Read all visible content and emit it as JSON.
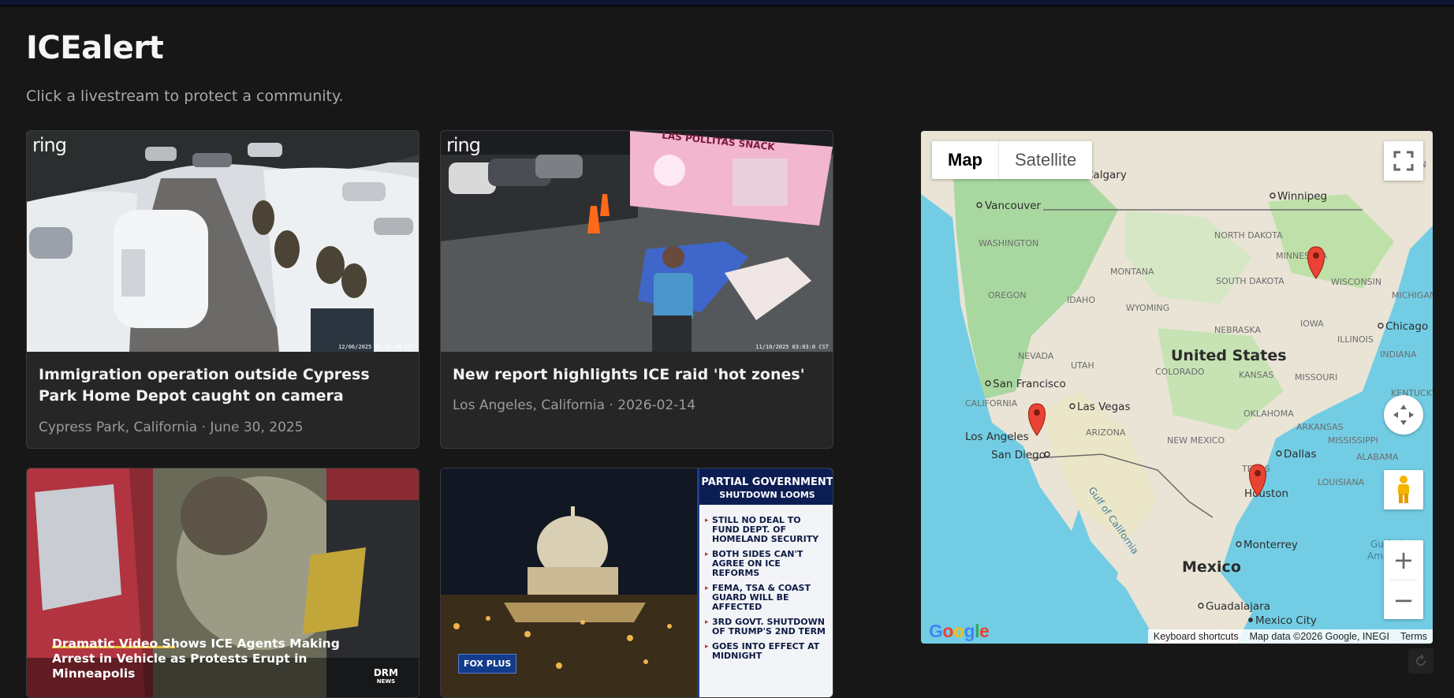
{
  "app": {
    "title": "ICEalert",
    "subtitle": "Click a livestream to protect a community."
  },
  "cards": [
    {
      "title": "Immigration operation outside Cypress Park Home Depot caught on camera",
      "meta": "Cypress Park, California · June 30, 2025",
      "brand": "ring",
      "timestamp": "12/06/2025 01:54:08 CST"
    },
    {
      "title": "New report highlights ICE raid 'hot zones'",
      "meta": "Los Angeles, California · 2026-02-14",
      "brand": "ring",
      "timestamp": "11/10/2025 03:03:0 CST",
      "sign": "LAS POLLITAS SNACK"
    },
    {
      "caption": "Dramatic Video Shows ICE Agents Making Arrest in Vehicle as Protests Erupt in Minneapolis",
      "logo": "DRM",
      "logo_sub": "NEWS"
    },
    {
      "headline1": "PARTIAL GOVERNMENT",
      "headline2": "SHUTDOWN LOOMS",
      "bullets": [
        "STILL NO DEAL TO FUND DEPT. OF HOMELAND SECURITY",
        "BOTH SIDES CAN'T AGREE ON ICE REFORMS",
        "FEMA, TSA & COAST GUARD WILL BE AFFECTED",
        "3RD GOVT. SHUTDOWN OF TRUMP'S 2ND TERM",
        "GOES INTO EFFECT AT MIDNIGHT"
      ],
      "logo": "FOX PLUS"
    }
  ],
  "map": {
    "toggle_map": "Map",
    "toggle_satellite": "Satellite",
    "country_labels": [
      "United States",
      "Mexico"
    ],
    "cities": [
      "Vancouver",
      "Winnipeg",
      "Calgary",
      "San Francisco",
      "Las Vegas",
      "Los Angeles",
      "San Diego",
      "Dallas",
      "Houston",
      "Chicago",
      "Monterrey",
      "Guadalajara",
      "Mexico City"
    ],
    "regions": [
      "WASHINGTON",
      "MONTANA",
      "NORTH DAKOTA",
      "MINNESOTA",
      "WISCONSIN",
      "MICHIGAN",
      "OREGON",
      "IDAHO",
      "WYOMING",
      "SOUTH DAKOTA",
      "IOWA",
      "ILLINOIS",
      "NEBRASKA",
      "NEVADA",
      "UTAH",
      "COLORADO",
      "KANSAS",
      "MISSOURI",
      "INDIANA",
      "KENTUCKY",
      "CALIFORNIA",
      "ARIZONA",
      "NEW MEXICO",
      "OKLAHOMA",
      "ARKANSAS",
      "MISSISSIPPI",
      "ALABAMA",
      "TEXAS",
      "LOUISIANA",
      "ON"
    ],
    "water_labels": [
      "Gulf of California",
      "Gulf of",
      "America"
    ],
    "markers": [
      "Minneapolis",
      "Los Angeles",
      "Houston"
    ],
    "google": "Google",
    "footer": [
      "Keyboard shortcuts",
      "Map data ©2026 Google, INEGI",
      "Terms"
    ],
    "zoom_in": "+",
    "zoom_out": "−"
  }
}
